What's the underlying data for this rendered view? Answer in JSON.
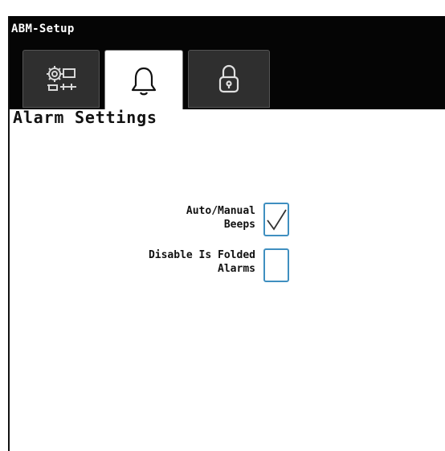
{
  "window": {
    "title": "ABM-Setup"
  },
  "tabs": [
    {
      "icon": "gears-icon",
      "active": false
    },
    {
      "icon": "bell-icon",
      "active": true
    },
    {
      "icon": "padlock-icon",
      "active": false
    }
  ],
  "main": {
    "heading": "Alarm Settings",
    "settings": [
      {
        "label_line1": "Auto/Manual",
        "label_line2": "Beeps",
        "checked": true
      },
      {
        "label_line1": "Disable Is Folded",
        "label_line2": "Alarms",
        "checked": false
      }
    ]
  },
  "colors": {
    "titlebar_bg": "#050505",
    "checkbox_border": "#3f8fc0"
  }
}
